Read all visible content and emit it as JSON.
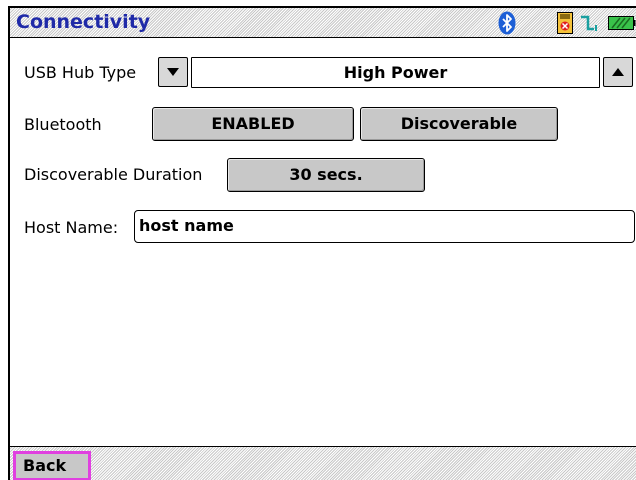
{
  "header": {
    "title": "Connectivity",
    "status_icons": [
      "bluetooth-icon",
      "memory-card-icon",
      "connection-icon",
      "battery-icon"
    ]
  },
  "usb_hub": {
    "label": "USB Hub Type",
    "value": "High Power"
  },
  "bluetooth": {
    "label": "Bluetooth",
    "state_button": "ENABLED",
    "mode_button": "Discoverable"
  },
  "discoverable_duration": {
    "label": "Discoverable Duration",
    "value": "30 secs."
  },
  "host_name": {
    "label": "Host Name:",
    "value": "host name"
  },
  "footer": {
    "back_label": "Back"
  },
  "colors": {
    "title": "#1f2aa8",
    "button": "#c8c8c8",
    "back_highlight": "#e040e0",
    "bluetooth": "#1d5fd6",
    "battery": "#39c24a"
  }
}
